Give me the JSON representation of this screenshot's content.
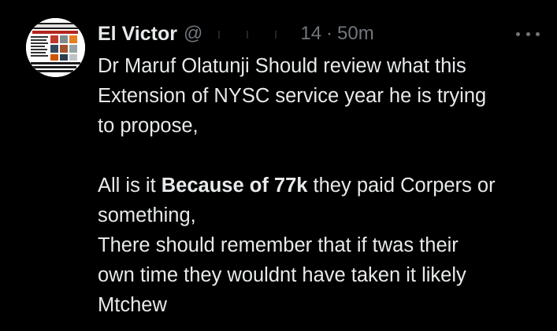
{
  "author": {
    "display_name": "El Victor",
    "handle_prefix": "@",
    "handle_suffix": "14",
    "avatar_icon": "profile-avatar-flyer"
  },
  "tweet": {
    "timestamp": "50m",
    "separator": "·",
    "more_icon": "more-dots-icon",
    "paragraph1": {
      "line1": "Dr Maruf Olatunji Should review what this",
      "line2": "Extension of NYSC service year he is trying",
      "line3": "to propose,"
    },
    "paragraph2": {
      "line1_start": "All is it ",
      "line1_bold": "Because of 77k",
      "line1_end": " they paid Corpers or",
      "line2": "something,",
      "line3": "There should remember that if twas their",
      "line4": "own time they wouldnt have taken it likely",
      "line5": "Mtchew"
    }
  },
  "colors": {
    "background": "#000000",
    "text_primary": "#e7e9ea",
    "text_secondary": "#71767b"
  }
}
